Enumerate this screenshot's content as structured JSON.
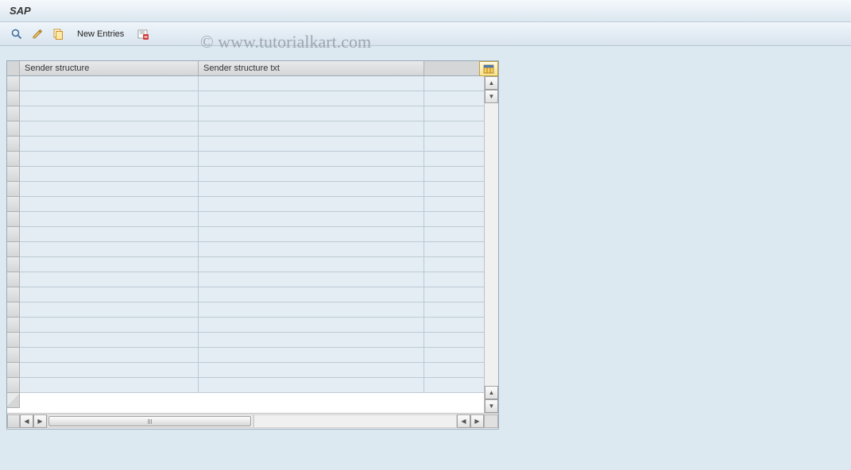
{
  "title": "SAP",
  "toolbar": {
    "new_entries_label": "New Entries"
  },
  "table": {
    "columns": {
      "col1": "Sender structure",
      "col2": "Sender structure txt"
    },
    "rows": [
      {
        "c1": "",
        "c2": ""
      },
      {
        "c1": "",
        "c2": ""
      },
      {
        "c1": "",
        "c2": ""
      },
      {
        "c1": "",
        "c2": ""
      },
      {
        "c1": "",
        "c2": ""
      },
      {
        "c1": "",
        "c2": ""
      },
      {
        "c1": "",
        "c2": ""
      },
      {
        "c1": "",
        "c2": ""
      },
      {
        "c1": "",
        "c2": ""
      },
      {
        "c1": "",
        "c2": ""
      },
      {
        "c1": "",
        "c2": ""
      },
      {
        "c1": "",
        "c2": ""
      },
      {
        "c1": "",
        "c2": ""
      },
      {
        "c1": "",
        "c2": ""
      },
      {
        "c1": "",
        "c2": ""
      },
      {
        "c1": "",
        "c2": ""
      },
      {
        "c1": "",
        "c2": ""
      },
      {
        "c1": "",
        "c2": ""
      },
      {
        "c1": "",
        "c2": ""
      },
      {
        "c1": "",
        "c2": ""
      },
      {
        "c1": "",
        "c2": ""
      }
    ]
  },
  "icons": {
    "search": "search-glass-icon",
    "edit": "pencil-edit-icon",
    "copy": "copy-icon",
    "delete": "delete-mark-icon",
    "table_settings": "table-settings-icon"
  },
  "watermark": "© www.tutorialkart.com"
}
